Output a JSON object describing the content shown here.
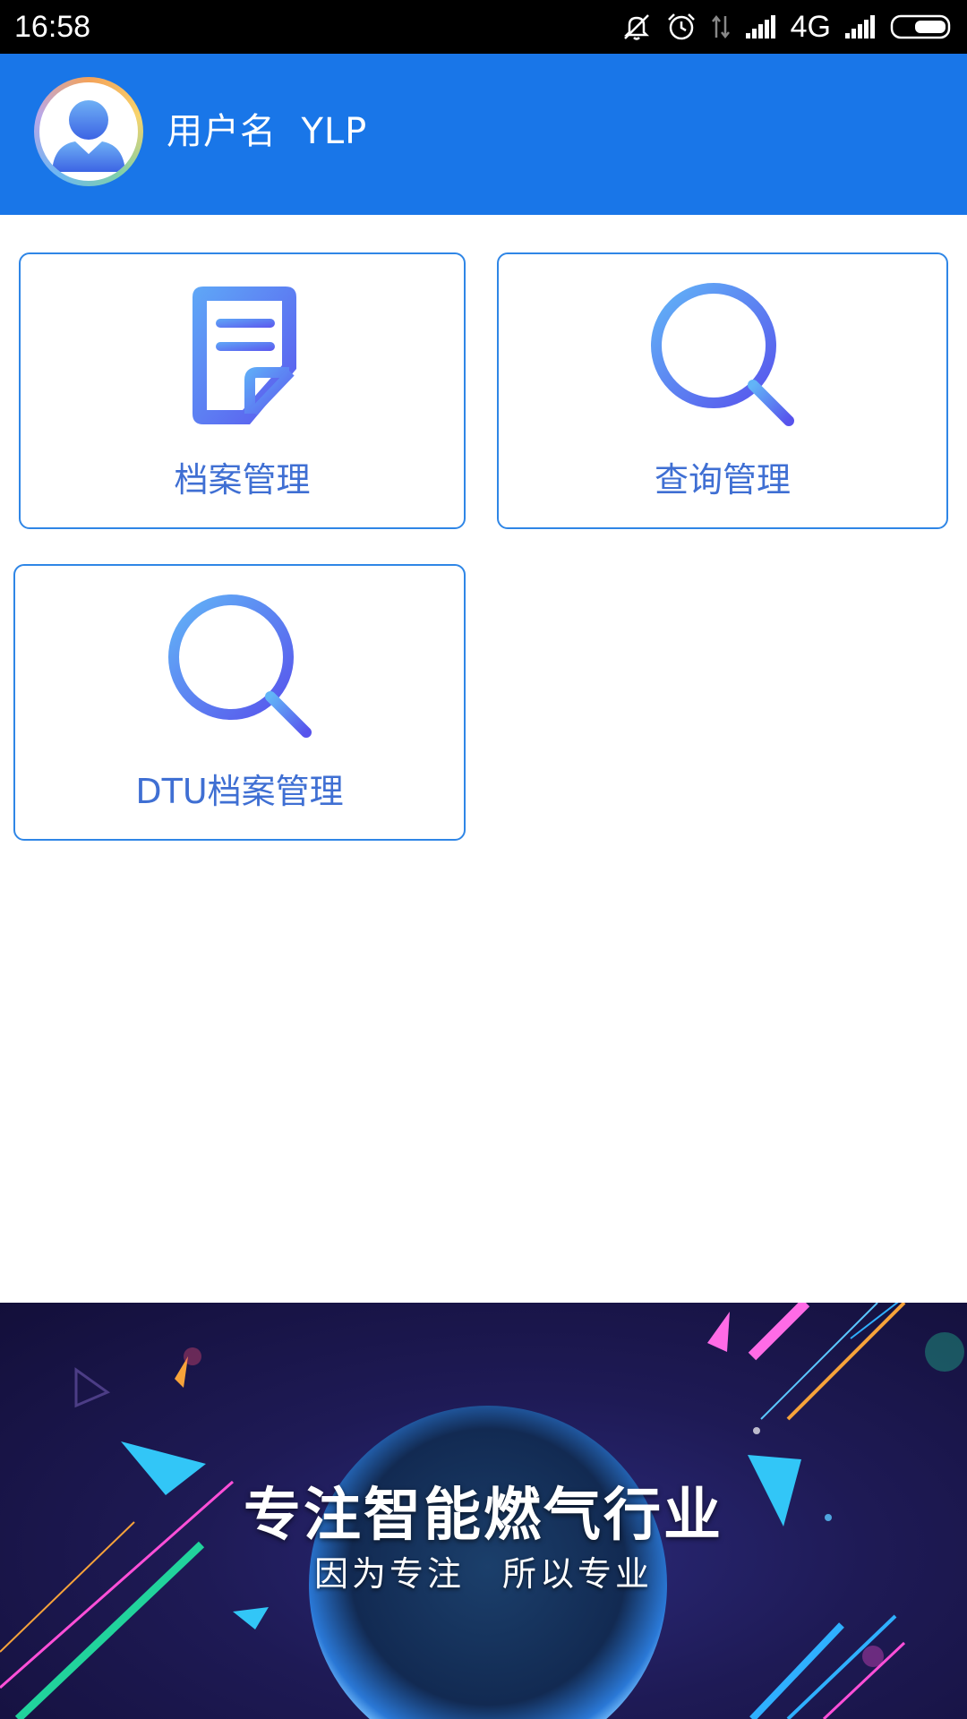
{
  "status_bar": {
    "time": "16:58",
    "network": "4G",
    "icons": [
      "mute-icon",
      "alarm-icon",
      "data-transfer-icon",
      "signal-icon",
      "signal-icon",
      "battery-icon"
    ]
  },
  "header": {
    "username_label": "用户名",
    "username_value": "YLP",
    "background_color": "#1976e8"
  },
  "menu": {
    "items": [
      {
        "label": "档案管理",
        "icon": "document-icon"
      },
      {
        "label": "查询管理",
        "icon": "search-icon"
      },
      {
        "label": "DTU档案管理",
        "icon": "search-icon"
      }
    ],
    "accent_color": "#2f86e6",
    "label_color": "#3f6fd3"
  },
  "banner": {
    "title": "专注智能燃气行业",
    "subtitle": "因为专注　所以专业"
  }
}
